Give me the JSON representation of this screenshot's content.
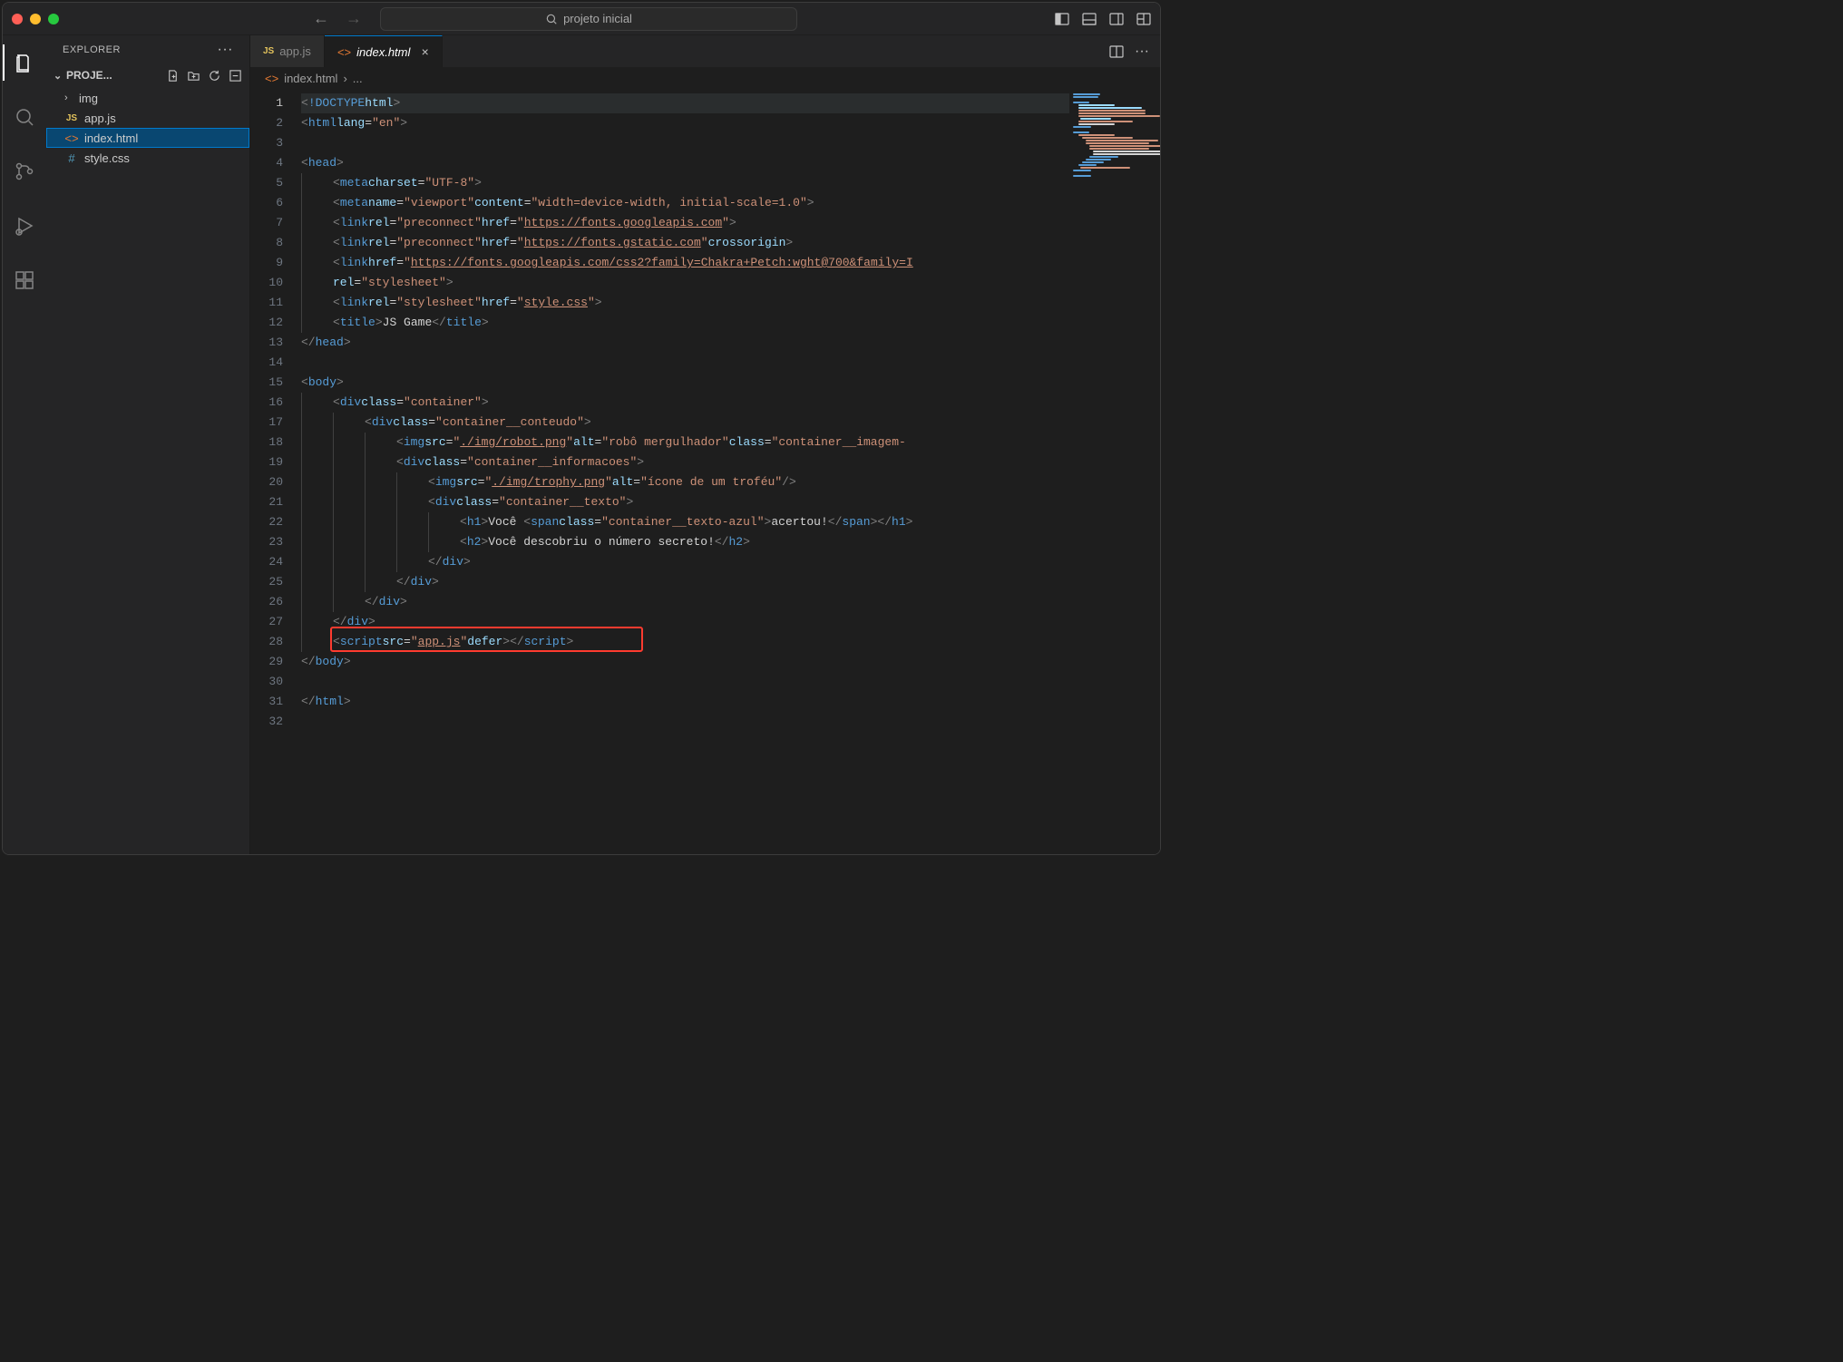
{
  "search_placeholder": "projeto inicial",
  "explorer_title": "EXPLORER",
  "project_name": "PROJE...",
  "tree": {
    "folder_img": "img",
    "file_appjs": "app.js",
    "file_index": "index.html",
    "file_style": "style.css"
  },
  "tabs": {
    "appjs": "app.js",
    "index": "index.html"
  },
  "breadcrumb": {
    "file": "index.html",
    "sep": "›",
    "ellipsis": "..."
  },
  "lines": [
    1,
    2,
    3,
    4,
    5,
    6,
    7,
    8,
    9,
    10,
    11,
    12,
    13,
    14,
    15,
    16,
    17,
    18,
    19,
    20,
    21,
    22,
    23,
    24,
    25,
    26,
    27,
    28,
    29,
    30,
    31,
    32
  ],
  "code": {
    "url_googleapis": "https://fonts.googleapis.com",
    "url_gstatic": "https://fonts.gstatic.com",
    "url_css2": "https://fonts.googleapis.com/css2?family=Chakra+Petch:wght@700&family=I",
    "style_css": "style.css",
    "title_text": "JS Game",
    "robot_png": "./img/robot.png",
    "robot_alt": "robô mergulhador",
    "trophy_png": "./img/trophy.png",
    "trophy_alt": "ícone de um troféu",
    "voce": "Você ",
    "acertou": "acertou!",
    "voce_desc": "Você descobriu o número secreto!",
    "appjs": "app.js"
  }
}
